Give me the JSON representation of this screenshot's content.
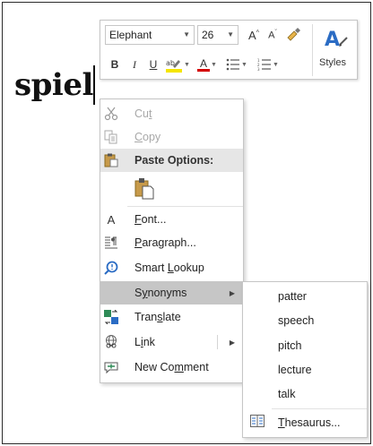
{
  "document": {
    "word": "spiel"
  },
  "mini_toolbar": {
    "font_name": "Elephant",
    "font_size": "26",
    "grow_font_label": "A",
    "shrink_font_label": "A",
    "bold_label": "B",
    "italic_label": "I",
    "underline_label": "U",
    "font_color_label": "A",
    "styles_label": "Styles",
    "colors": {
      "highlight": "#f5e500",
      "font_color": "#d40000",
      "styles_icon": "#2b6cc4"
    }
  },
  "context_menu": {
    "cut": {
      "pre": "Cu",
      "u": "t",
      "post": ""
    },
    "copy": {
      "pre": "",
      "u": "C",
      "post": "opy"
    },
    "paste_options": "Paste Options:",
    "font": {
      "pre": "",
      "u": "F",
      "post": "ont..."
    },
    "paragraph": {
      "pre": "",
      "u": "P",
      "post": "aragraph..."
    },
    "smart_lookup": {
      "pre": "Smart ",
      "u": "L",
      "post": "ookup"
    },
    "synonyms": {
      "pre": "S",
      "u": "y",
      "post": "nonyms"
    },
    "translate": {
      "pre": "Tran",
      "u": "s",
      "post": "late"
    },
    "link": {
      "pre": "L",
      "u": "i",
      "post": "nk"
    },
    "new_comment": {
      "pre": "New Co",
      "u": "m",
      "post": "ment"
    }
  },
  "synonyms_submenu": {
    "items": [
      "patter",
      "speech",
      "pitch",
      "lecture",
      "talk"
    ],
    "thesaurus": {
      "pre": "",
      "u": "T",
      "post": "hesaurus..."
    }
  }
}
